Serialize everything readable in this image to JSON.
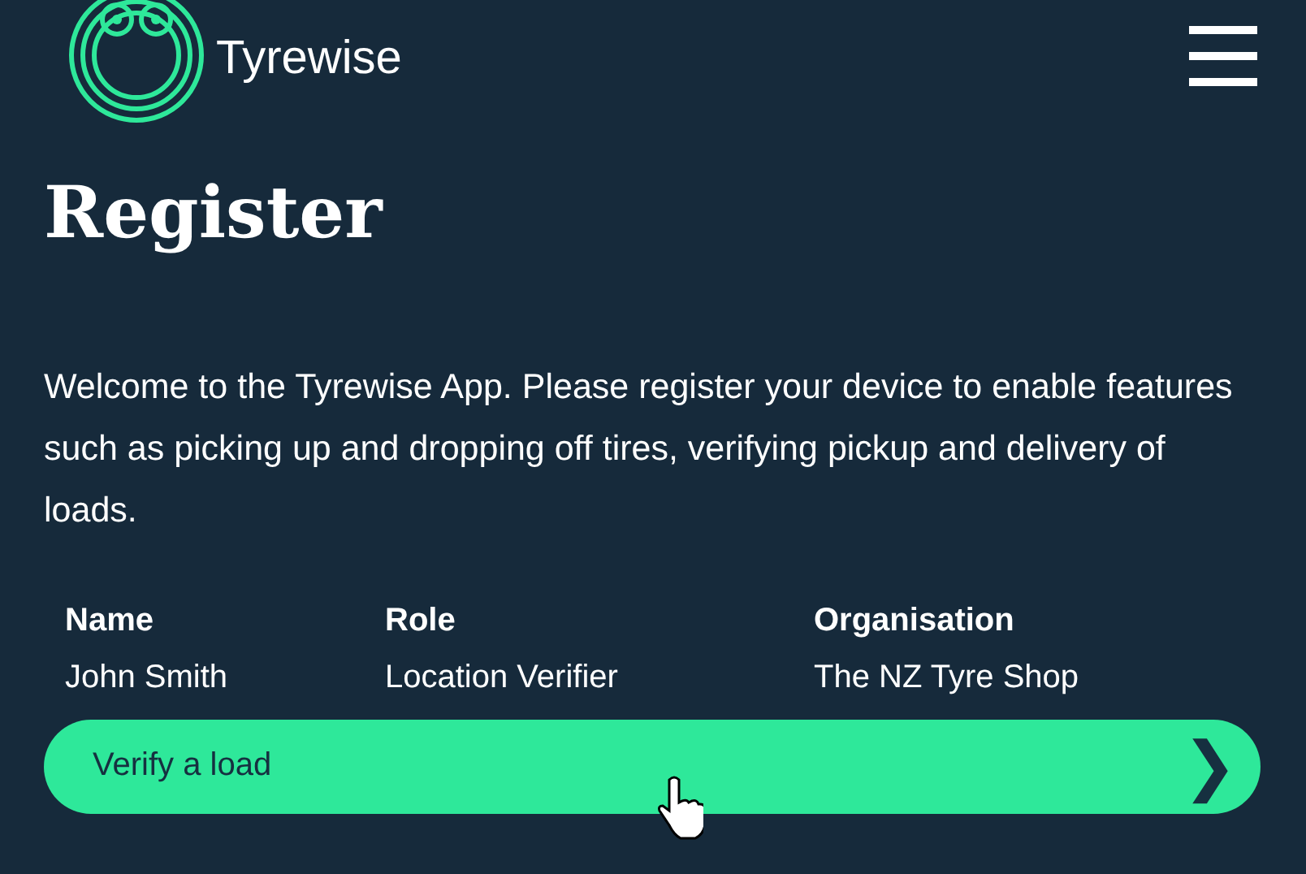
{
  "header": {
    "brand": "Tyrewise"
  },
  "title": "Register",
  "intro": "Welcome to the Tyrewise App. Please register your device to enable features such as picking up and dropping off tires, verifying pickup and delivery of loads.",
  "details": {
    "columns": [
      "Name",
      "Role",
      "Organisation"
    ],
    "values": [
      "John Smith",
      "Location Verifier",
      "The NZ Tyre Shop"
    ]
  },
  "action": {
    "label": "Verify a load",
    "chevron": "❯"
  }
}
